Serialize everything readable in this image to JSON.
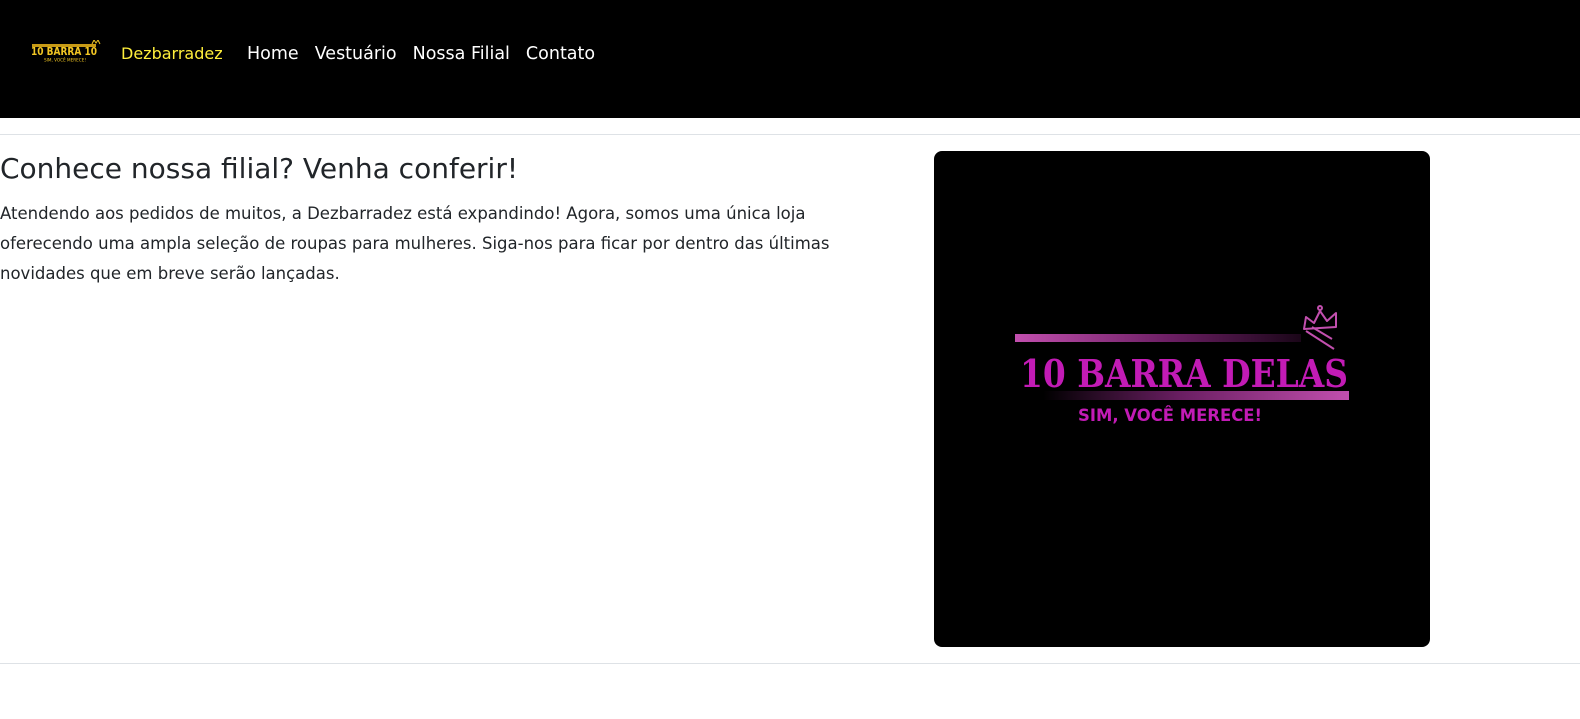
{
  "header": {
    "brand_logo_text": "10 BARRA 10",
    "brand_logo_tagline": "SIM, VOCÊ MERECE!",
    "brand_name": "Dezbarradez",
    "nav": [
      {
        "label": "Home"
      },
      {
        "label": "Vestuário"
      },
      {
        "label": "Nossa Filial"
      },
      {
        "label": "Contato"
      }
    ]
  },
  "main": {
    "title": "Conhece nossa filial? Venha conferir!",
    "description": "Atendendo aos pedidos de muitos, a Dezbarradez está expandindo! Agora, somos uma única loja oferecendo uma ampla seleção de roupas para mulheres. Siga-nos para ficar por dentro das últimas novidades que em breve serão lançadas.",
    "branch_logo": {
      "text": "10 BARRA DELAS",
      "tagline": "SIM, VOCÊ MERECE!",
      "icon": "crown-icon"
    }
  },
  "colors": {
    "navbar_bg": "#000000",
    "brand": "#ffef3b",
    "nav_link": "#ffffff",
    "branch_accent": "#c21bb5",
    "text": "#212529"
  }
}
